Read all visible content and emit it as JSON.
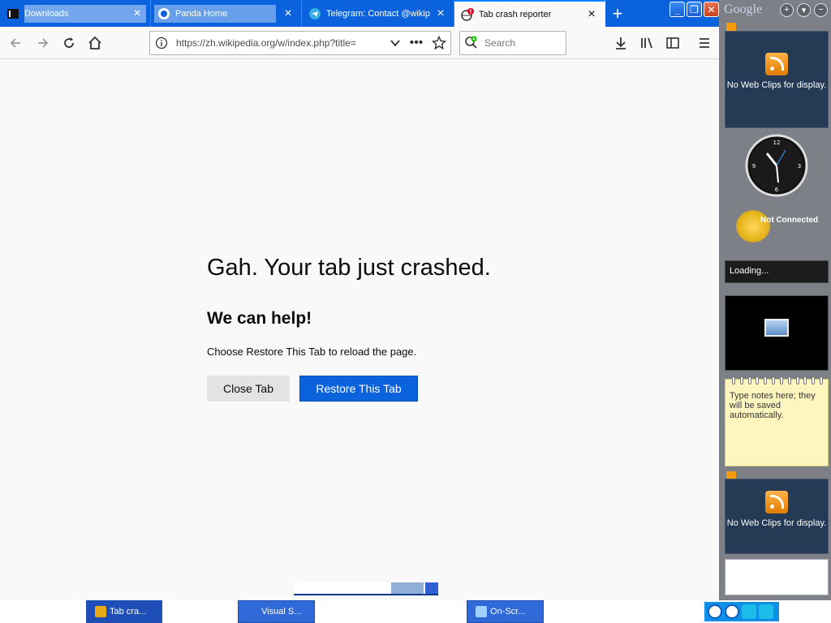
{
  "tabs": [
    {
      "title": "Downloads",
      "favicon": "terminal-icon"
    },
    {
      "title": "Panda Home",
      "favicon": "panda-icon"
    },
    {
      "title": "Telegram: Contact @wikip",
      "favicon": "telegram-icon"
    },
    {
      "title": "Tab crash reporter",
      "favicon": "globe-crash-icon",
      "active": true
    }
  ],
  "toolbar": {
    "url": "https://zh.wikipedia.org/w/index.php?title=",
    "search_placeholder": "Search"
  },
  "page": {
    "title": "Gah. Your tab just crashed.",
    "subtitle": "We can help!",
    "description": "Choose Restore This Tab to reload the page.",
    "close_tab_label": "Close Tab",
    "restore_label": "Restore This Tab"
  },
  "sidebar": {
    "logo": "Google",
    "webclips_text": "No Web Clips for display.",
    "weather_status": "Not Connected",
    "loading_text": "Loading...",
    "notes_text": "Type notes here; they will be saved automatically.",
    "webclips_text_2": "No Web Clips for display."
  },
  "taskbar": {
    "items": [
      "Tab cra...",
      "Visual S...",
      "On-Scr..."
    ]
  },
  "colors": {
    "tab_strip": "#0a63dd",
    "restore_button": "#0a63dd",
    "taskbar_button": "#2f6ad8"
  }
}
